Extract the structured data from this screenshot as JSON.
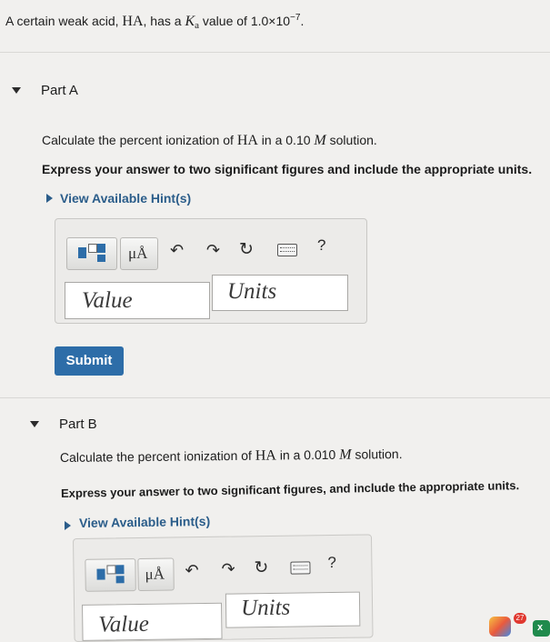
{
  "intro": {
    "prefix": "A certain weak acid, ",
    "acid": "HA",
    "middle": ", has a ",
    "k": "K",
    "k_sub": "a",
    "suffix_value": " value of 1.0×10",
    "exponent": "−7",
    "period": "."
  },
  "part_a": {
    "title": "Part A",
    "question_prefix": "Calculate the percent ionization of ",
    "acid": "HA",
    "question_middle": " in a 0.10 ",
    "molar": "M",
    "question_suffix": " solution.",
    "instruction": "Express your answer to two significant figures and include the appropriate units.",
    "hint": "View Available Hint(s)",
    "unit_symbol": "μÅ",
    "help": "?",
    "value_placeholder": "Value",
    "units_placeholder": "Units",
    "submit": "Submit"
  },
  "part_b": {
    "title": "Part B",
    "question_prefix": "Calculate the percent ionization of ",
    "acid": "HA",
    "question_middle": " in a 0.010 ",
    "molar": "M",
    "question_suffix": " solution.",
    "instruction": "Express your answer to two significant figures, and include the appropriate units.",
    "hint": "View Available Hint(s)",
    "unit_symbol": "μÅ",
    "help": "?",
    "value_placeholder": "Value",
    "units_placeholder": "Units"
  },
  "dock": {
    "badge": "27"
  },
  "icons": {
    "undo": "undo-icon",
    "redo": "redo-icon",
    "reset": "reset-icon",
    "keyboard": "keyboard-icon",
    "templates": "templates-icon"
  },
  "colors": {
    "accent": "#2d6da8",
    "hint": "#2b5d8a"
  }
}
